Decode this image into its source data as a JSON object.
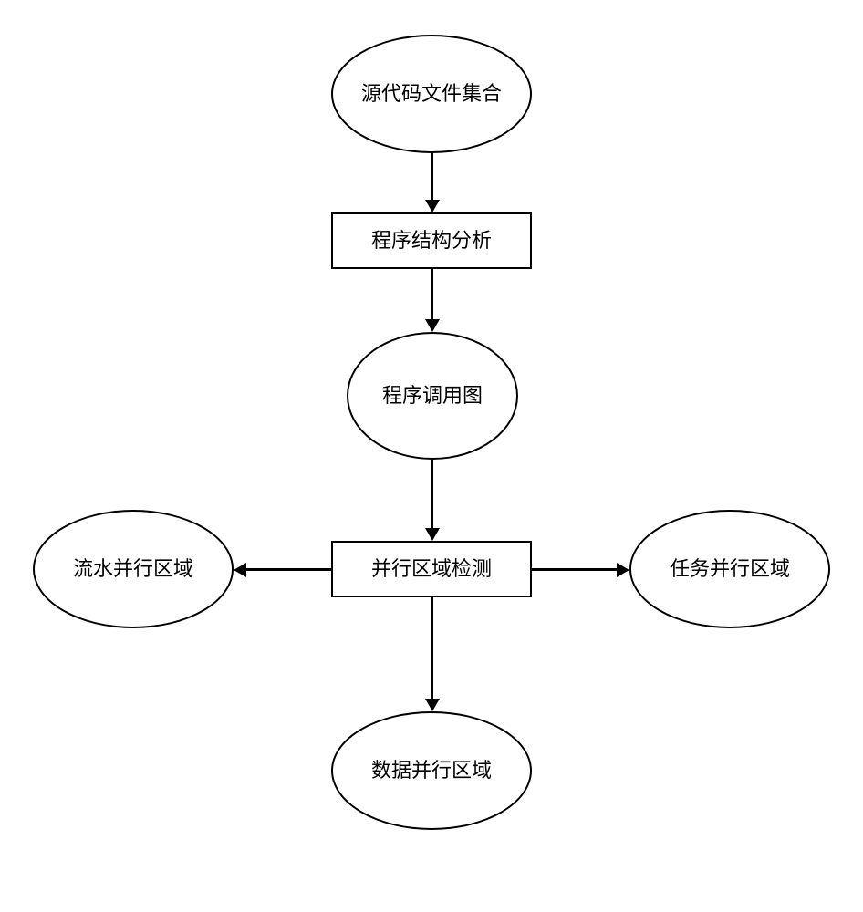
{
  "nodes": {
    "source_code": "源代码文件集合",
    "program_analysis": "程序结构分析",
    "call_graph": "程序调用图",
    "parallel_detection": "并行区域检测",
    "pipeline_parallel": "流水并行区域",
    "task_parallel": "任务并行区域",
    "data_parallel": "数据并行区域"
  }
}
